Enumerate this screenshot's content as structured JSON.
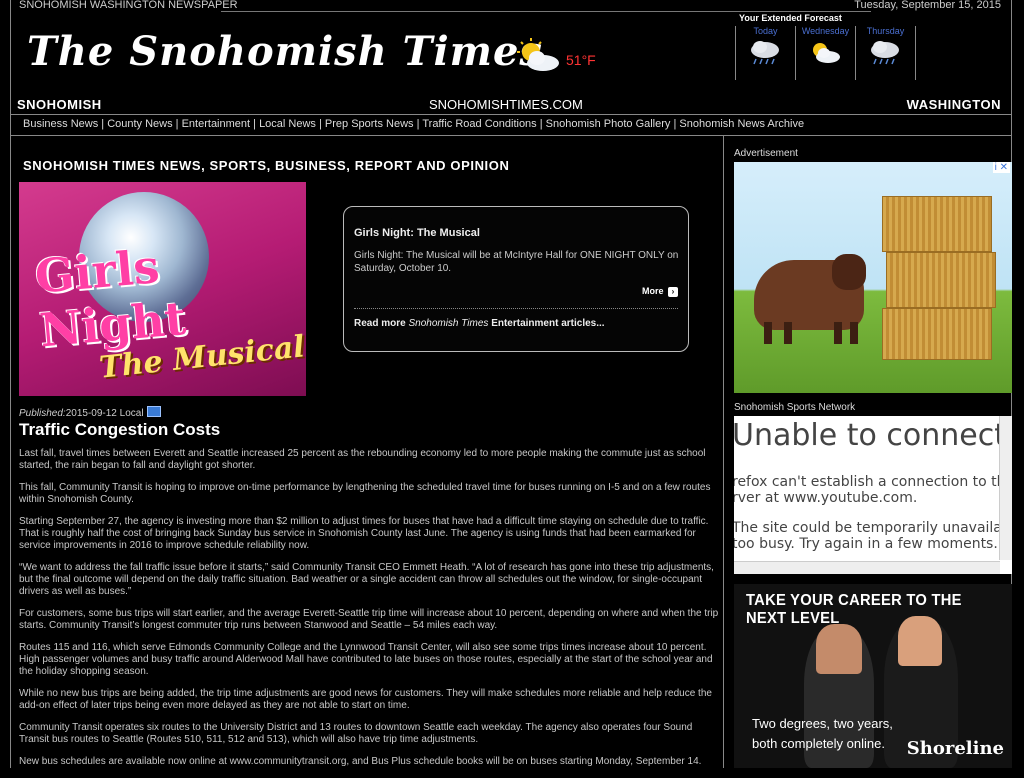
{
  "topbar": {
    "site_label": "SNOHOMISH WASHINGTON NEWSPAPER",
    "date": "Tuesday, September 15, 2015"
  },
  "masthead": {
    "logo": "The Snohomish Times",
    "current_weather_icon": "partly-sunny-icon",
    "temperature": "51°F",
    "temperature_color": "#ff3333"
  },
  "forecast": {
    "title": "Your Extended Forecast",
    "days": [
      {
        "day": "Today",
        "icon": "rain-cloud-icon"
      },
      {
        "day": "Wednesday",
        "icon": "partly-sunny-icon"
      },
      {
        "day": "Thursday",
        "icon": "rain-cloud-icon"
      }
    ]
  },
  "titlebar": {
    "left": "SNOHOMISH",
    "center": "SNOHOMISHTIMES.COM",
    "right": "WASHINGTON"
  },
  "nav": {
    "links": [
      "Business News",
      "County News",
      "Entertainment",
      "Local News",
      "Prep Sports News",
      "Traffic Road Conditions",
      "Snohomish Photo Gallery",
      "Snohomish News Archive"
    ],
    "separator": " | "
  },
  "main": {
    "section_heading": "SNOHOMISH TIMES NEWS, SPORTS, BUSINESS, REPORT AND OPINION",
    "feature_image": {
      "line1": "Girls Night",
      "line2": "The Musical"
    },
    "feature_box": {
      "title": "Girls Night: The Musical",
      "description": "Girls Night: The Musical will be at McIntyre Hall for ONE NIGHT ONLY on Saturday, October 10.",
      "more_label": "More",
      "readmore_prefix": "Read more ",
      "readmore_italic": "Snohomish Times",
      "readmore_suffix": " Entertainment articles..."
    },
    "article": {
      "published_label": "Published:",
      "published_date": "2015-09-12",
      "category": "Local",
      "title": "Traffic Congestion Costs",
      "paragraphs": [
        "Last fall, travel times between Everett and Seattle increased 25 percent as the rebounding economy led to more people making the commute just as school started, the rain began to fall and daylight got shorter.",
        "This fall, Community Transit is hoping to improve on-time performance by lengthening the scheduled travel time for buses running on I-5 and on a few routes within Snohomish County.",
        "Starting September 27, the agency is investing more than $2 million to adjust times for buses that have had a difficult time staying on schedule due to traffic. That is roughly half the cost of bringing back Sunday bus service in Snohomish County last June. The agency is using funds that had been earmarked for service improvements in 2016 to improve schedule reliability now.",
        "“We want to address the fall traffic issue before it starts,” said Community Transit CEO Emmett Heath. “A lot of research has gone into these trip adjustments, but the final outcome will depend on the daily traffic situation. Bad weather or a single accident can throw all schedules out the window, for single-occupant drivers as well as buses.”",
        "For customers, some bus trips will start earlier, and the average Everett-Seattle trip time will increase about 10 percent, depending on where and when the trip starts. Community Transit’s longest commuter trip runs between Stanwood and Seattle – 54 miles each way.",
        "Routes 115 and 116, which serve Edmonds Community College and the Lynnwood Transit Center, will also see some trips times increase about 10 percent. High passenger volumes and busy traffic around Alderwood Mall have contributed to late buses on those routes, especially at the start of the school year and the holiday shopping season.",
        "While no new bus trips are being added, the trip time adjustments are good news for customers. They will make schedules more reliable and help reduce the add-on effect of later trips being even more delayed as they are not able to start on time.",
        "Community Transit operates six routes to the University District and 13 routes to downtown Seattle each weekday. The agency also operates four Sound Transit bus routes to Seattle (Routes 510, 511, 512 and 513), which will also have trip time adjustments.",
        "New bus schedules are available now online at www.communitytransit.org, and Bus Plus schedule books will be on buses starting Monday, September 14."
      ]
    }
  },
  "sidebar": {
    "ad_label": "Advertisement",
    "ad_badge": "i ✕",
    "sports_label": "Snohomish Sports Network",
    "error": {
      "heading": "Unable to connect",
      "line1": "refox can't establish a connection to the",
      "line2": "rver at www.youtube.com.",
      "line3": "The site could be temporarily unavailable o",
      "line4": "too busy. Try again in a few moments."
    },
    "career_ad": {
      "headline": "TAKE YOUR CAREER TO THE NEXT LEVEL",
      "tagline1": "Two degrees, two years,",
      "tagline2": "both completely online.",
      "brand": "Shoreline"
    }
  }
}
